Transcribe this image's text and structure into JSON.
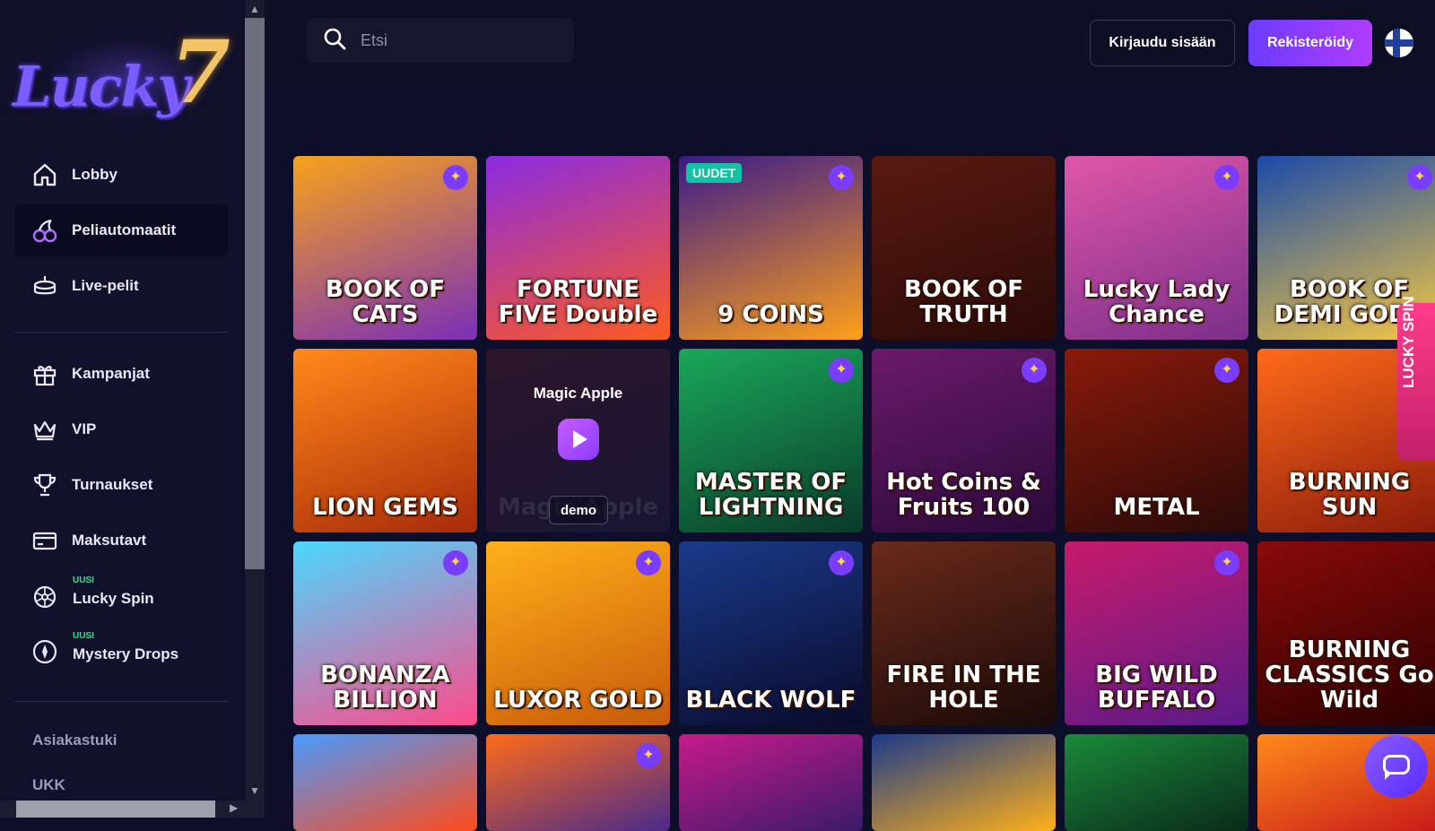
{
  "brand": {
    "logo_text": "Lucky",
    "logo_seven": "7"
  },
  "sidebar": {
    "items": [
      {
        "label": "Lobby",
        "icon": "home-icon"
      },
      {
        "label": "Peliautomaatit",
        "icon": "cherries-icon",
        "active": true
      },
      {
        "label": "Live-pelit",
        "icon": "cake-icon"
      },
      {
        "label": "Kampanjat",
        "icon": "gift-icon"
      },
      {
        "label": "VIP",
        "icon": "crown-icon"
      },
      {
        "label": "Turnaukset",
        "icon": "trophy-icon"
      },
      {
        "label": "Maksutavt",
        "icon": "card-icon"
      },
      {
        "label": "Lucky Spin",
        "icon": "wheel-icon",
        "tag": "UUSI"
      },
      {
        "label": "Mystery Drops",
        "icon": "compass-icon",
        "tag": "UUSI"
      }
    ],
    "footer_links": [
      "Asiakastuki",
      "UKK"
    ]
  },
  "header": {
    "search_placeholder": "Etsi",
    "login_label": "Kirjaudu sisään",
    "register_label": "Rekisteröidy",
    "language": "fi-flag"
  },
  "games": [
    {
      "title": "BOOK OF CATS",
      "colors": [
        "#f7a21b",
        "#7a2fb8"
      ],
      "star": true
    },
    {
      "title": "FORTUNE FIVE Double",
      "colors": [
        "#8a2be2",
        "#ff5a1f"
      ],
      "star": false
    },
    {
      "title": "9 COINS",
      "colors": [
        "#3a1a8a",
        "#ff9f1a"
      ],
      "star": true,
      "badge": "UUDET"
    },
    {
      "title": "BOOK OF TRUTH",
      "colors": [
        "#5a1a10",
        "#2a0a08"
      ],
      "star": false
    },
    {
      "title": "Lucky Lady Chance",
      "colors": [
        "#e056a8",
        "#7a2f8a"
      ],
      "star": true
    },
    {
      "title": "BOOK OF DEMI GODS",
      "colors": [
        "#1a4aa8",
        "#f5c842"
      ],
      "star": true
    },
    {
      "title": "LION GEMS",
      "colors": [
        "#ff8a1a",
        "#a82a0a"
      ],
      "star": false
    },
    {
      "title": "Magic Apple",
      "colors": [
        "#6a1a1a",
        "#2a1a3a"
      ],
      "star": false,
      "hovered": true,
      "demo_label": "demo"
    },
    {
      "title": "MASTER OF LIGHTNING",
      "colors": [
        "#1aa85a",
        "#0a3a2a"
      ],
      "star": true
    },
    {
      "title": "Hot Coins & Fruits 100",
      "colors": [
        "#6a1a6a",
        "#2a0a3a"
      ],
      "star": true
    },
    {
      "title": "METAL",
      "colors": [
        "#8a1a0a",
        "#2a0a08"
      ],
      "star": true
    },
    {
      "title": "BURNING SUN",
      "colors": [
        "#ff6a1a",
        "#8a1a0a"
      ],
      "star": false
    },
    {
      "title": "BONANZA BILLION",
      "colors": [
        "#4ad8ff",
        "#ff4a8a"
      ],
      "star": true
    },
    {
      "title": "LUXOR GOLD",
      "colors": [
        "#ffb01a",
        "#c85a0a"
      ],
      "star": true
    },
    {
      "title": "BLACK WOLF",
      "colors": [
        "#1a3a8a",
        "#0a0a2a"
      ],
      "star": true
    },
    {
      "title": "FIRE IN THE HOLE",
      "colors": [
        "#6a2a1a",
        "#1a0a0a"
      ],
      "star": false
    },
    {
      "title": "BIG WILD BUFFALO",
      "colors": [
        "#c81a6a",
        "#5a1a8a"
      ],
      "star": true
    },
    {
      "title": "BURNING CLASSICS Go Wild",
      "colors": [
        "#8a0a0a",
        "#2a0000"
      ],
      "star": false
    },
    {
      "title": "",
      "colors": [
        "#4a9aff",
        "#ff4a1a"
      ],
      "star": false
    },
    {
      "title": "",
      "colors": [
        "#ff6a1a",
        "#4a2a8a"
      ],
      "star": true
    },
    {
      "title": "",
      "colors": [
        "#c81a8a",
        "#3a1a6a"
      ],
      "star": false
    },
    {
      "title": "",
      "colors": [
        "#1a3a8a",
        "#ffb01a"
      ],
      "star": false
    },
    {
      "title": "",
      "colors": [
        "#1a8a3a",
        "#0a2a1a"
      ],
      "star": false
    },
    {
      "title": "",
      "colors": [
        "#ff8a1a",
        "#c81a1a"
      ],
      "star": false
    }
  ],
  "side_promo": {
    "label": "LUCKY SPIN"
  },
  "chat": {
    "icon": "chat-icon"
  }
}
